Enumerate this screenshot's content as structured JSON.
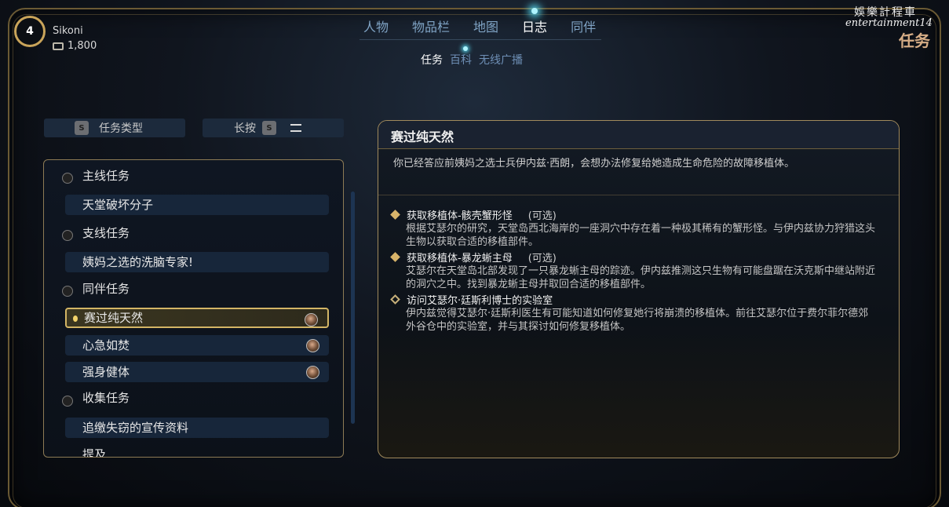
{
  "player": {
    "level": "4",
    "name": "Sikoni",
    "currency": "1,800"
  },
  "nav": {
    "tabs": [
      "人物",
      "物品栏",
      "地图",
      "日志",
      "同伴"
    ],
    "active": "日志"
  },
  "subnav": {
    "tabs": [
      "任务",
      "百科",
      "无线广播"
    ],
    "active": "任务"
  },
  "watermark": {
    "line1": "娛樂計程車",
    "line2": "entertainment14",
    "tag": "任务"
  },
  "sort": {
    "type_key": "S",
    "type_label": "任务类型",
    "hold_label": "长按",
    "hold_key": "S"
  },
  "quest_list": {
    "categories": [
      "主线任务",
      "支线任务",
      "同伴任务",
      "收集任务",
      "提及"
    ],
    "quests": {
      "main_0": "天堂破坏分子",
      "side_0": "姨妈之选的洗脑专家!",
      "companion_0": "赛过纯天然",
      "companion_1": "心急如焚",
      "companion_2": "强身健体",
      "collect_0": "追缴失窃的宣传资料"
    },
    "selected": "赛过纯天然"
  },
  "detail": {
    "title": "赛过纯天然",
    "description": "你已经答应前姨妈之选士兵伊内兹·西朗，会想办法修复给她造成生命危险的故障移植体。",
    "objectives": [
      {
        "title": "获取移植体-骸壳蟹形怪",
        "optional": "(可选)",
        "body": "根据艾瑟尔的研究，天堂岛西北海岸的一座洞穴中存在着一种极其稀有的蟹形怪。与伊内兹协力狩猎这头生物以获取合适的移植部件。"
      },
      {
        "title": "获取移植体-暴龙蜥主母",
        "optional": "(可选)",
        "body": "艾瑟尔在天堂岛北部发现了一只暴龙蜥主母的踪迹。伊内兹推测这只生物有可能盘踞在沃克斯中继站附近的洞穴之中。找到暴龙蜥主母并取回合适的移植部件。"
      },
      {
        "title": "访问艾瑟尔·廷斯利博士的实验室",
        "optional": "",
        "body": "伊内兹觉得艾瑟尔·廷斯利医生有可能知道如何修复她行将崩溃的移植体。前往艾瑟尔位于费尔菲尔德郊外谷仓中的实验室，并与其探讨如何修复移植体。"
      }
    ]
  },
  "colors": {
    "accent_gold": "#d3b565",
    "accent_cyan": "#56d7ee",
    "nav_blue": "#7fa3c4"
  }
}
